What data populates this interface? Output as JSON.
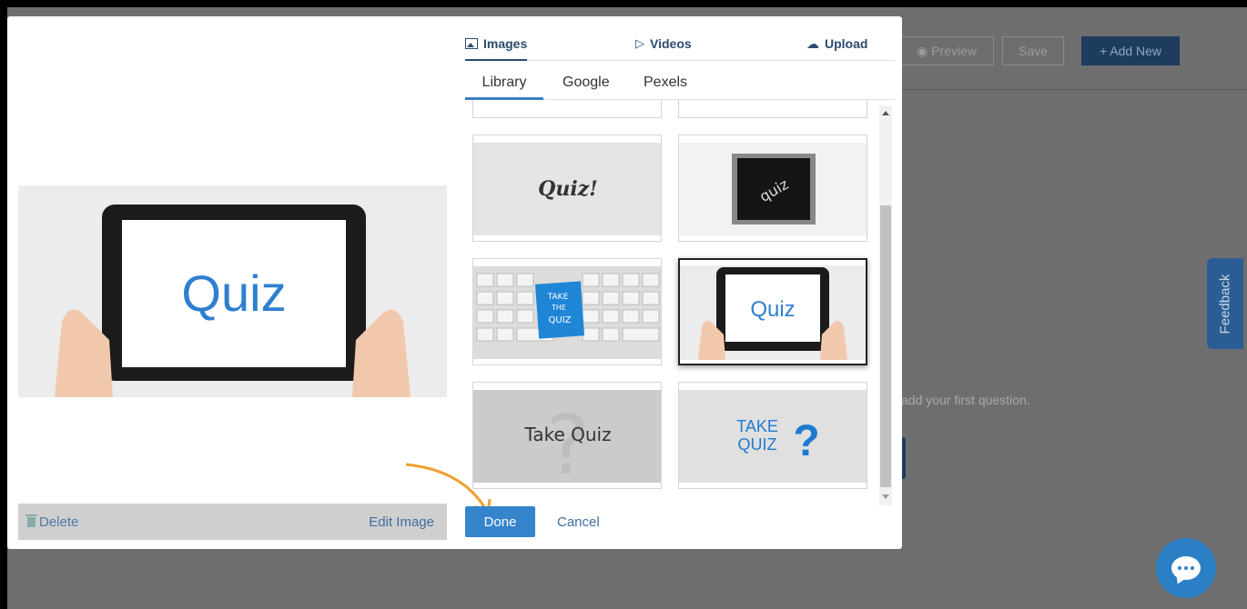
{
  "background": {
    "header_buttons": {
      "preview": "Preview",
      "save": "Save",
      "add_new": "+ Add New"
    },
    "hint_text": "add your first question.",
    "feedback_tab": "Feedback"
  },
  "modal": {
    "tabs": {
      "images": "Images",
      "videos": "Videos",
      "upload": "Upload"
    },
    "subtabs": {
      "library": "Library",
      "google": "Google",
      "pexels": "Pexels"
    },
    "preview": {
      "image_text": "Quiz",
      "delete_label": "Delete",
      "edit_label": "Edit Image"
    },
    "tiles": [
      {
        "id": "quiz-excl",
        "text": "Quiz!"
      },
      {
        "id": "chalkboard",
        "text": "quiz"
      },
      {
        "id": "keyboard",
        "text_lines": [
          "TAKE",
          "THE",
          "QUIZ"
        ]
      },
      {
        "id": "tablet",
        "text": "Quiz",
        "selected": true
      },
      {
        "id": "take-quiz-hand",
        "text": "Take Quiz"
      },
      {
        "id": "take-quiz-q",
        "text_lines": [
          "TAKE",
          "QUIZ"
        ],
        "symbol": "?"
      }
    ],
    "footer": {
      "done": "Done",
      "cancel": "Cancel"
    }
  },
  "colors": {
    "accent": "#3584cc",
    "nav_text": "#2c4a6e",
    "chat": "#2b7fc4",
    "arrow": "#f0a030"
  }
}
